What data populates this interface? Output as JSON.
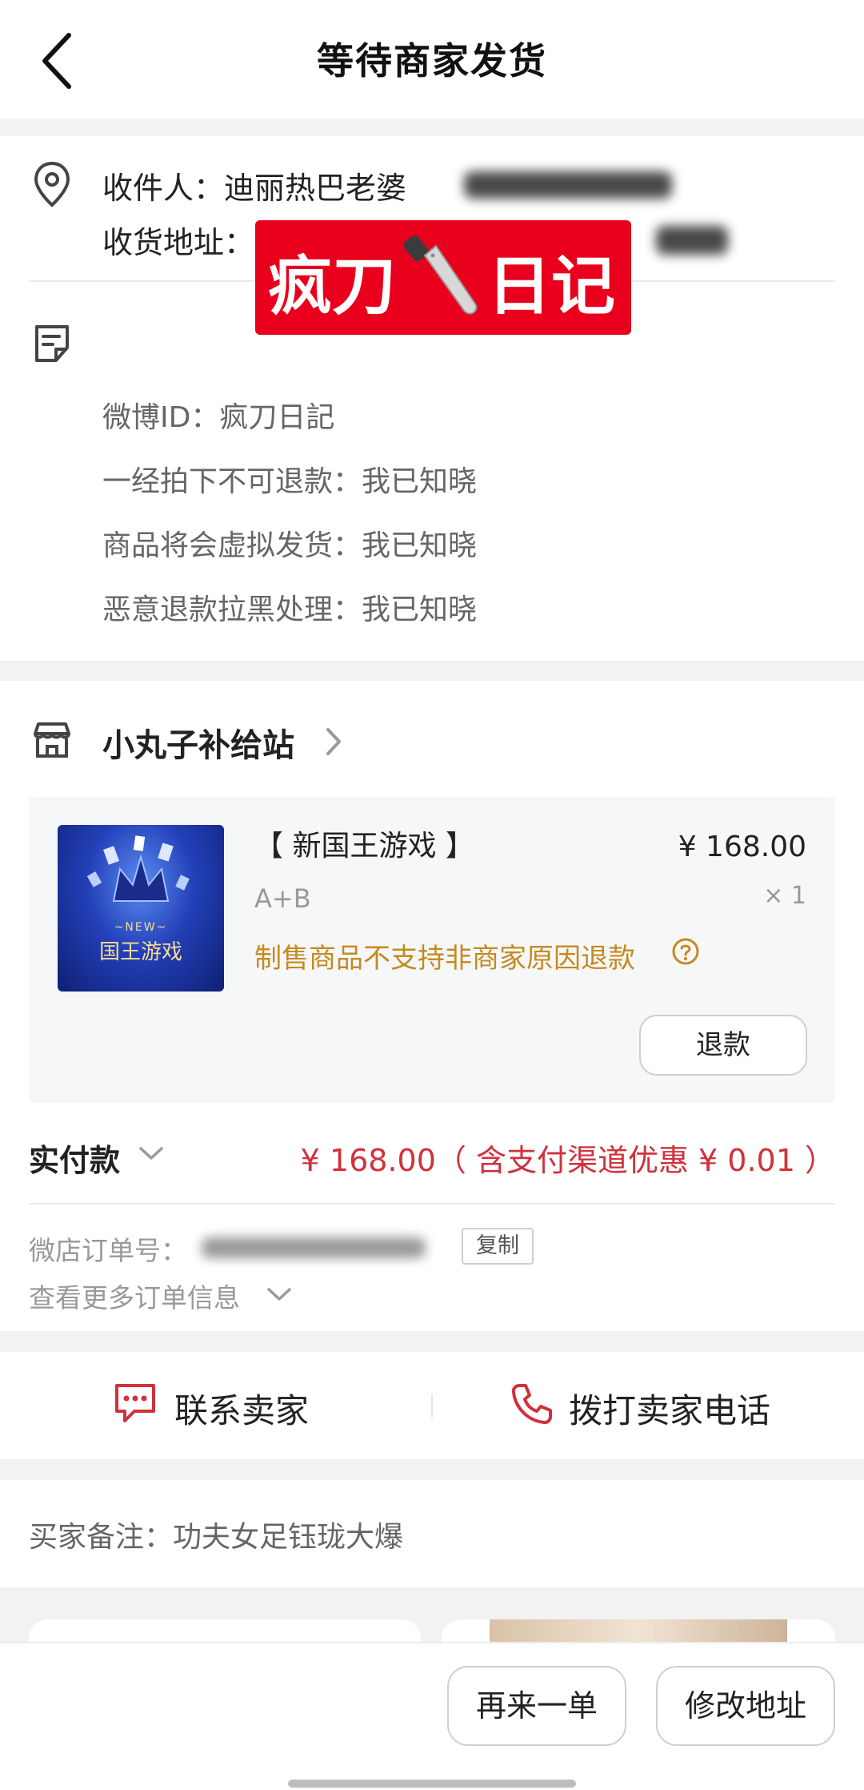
{
  "header": {
    "title": "等待商家发货"
  },
  "address": {
    "recipient_label": "收件人：",
    "recipient_name": "迪丽热巴老婆",
    "address_label": "收货地址："
  },
  "sticker": {
    "left_text": "疯刀",
    "right_text": "日记"
  },
  "notes": [
    "微博ID：疯刀日記",
    "一经拍下不可退款：我已知晓",
    "商品将会虚拟发货：我已知晓",
    "恶意退款拉黑处理：我已知晓"
  ],
  "shop": {
    "name": "小丸子补给站"
  },
  "product": {
    "title": "【 新国王游戏 】",
    "price": "¥ 168.00",
    "spec": "A+B",
    "quantity": "× 1",
    "warning": "制售商品不支持非商家原因退款",
    "refund_label": "退款",
    "thumb_new": "~NEW~",
    "thumb_name": "国王游戏"
  },
  "payment": {
    "label": "实付款",
    "amount": "¥ 168.00（ 含支付渠道优惠 ¥ 0.01 ）"
  },
  "order": {
    "number_label": "微店订单号：",
    "copy_label": "复制",
    "more_label": "查看更多订单信息"
  },
  "contact": {
    "chat_label": "联系卖家",
    "call_label": "拨打卖家电话"
  },
  "buyer_note": {
    "text": "买家备注：功夫女足钰珑大爆"
  },
  "bottom": {
    "reorder_label": "再来一单",
    "change_address_label": "修改地址"
  },
  "colors": {
    "accent_red": "#d0313c",
    "warning_orange": "#c58a1e",
    "sticker_red": "#e8001c"
  }
}
